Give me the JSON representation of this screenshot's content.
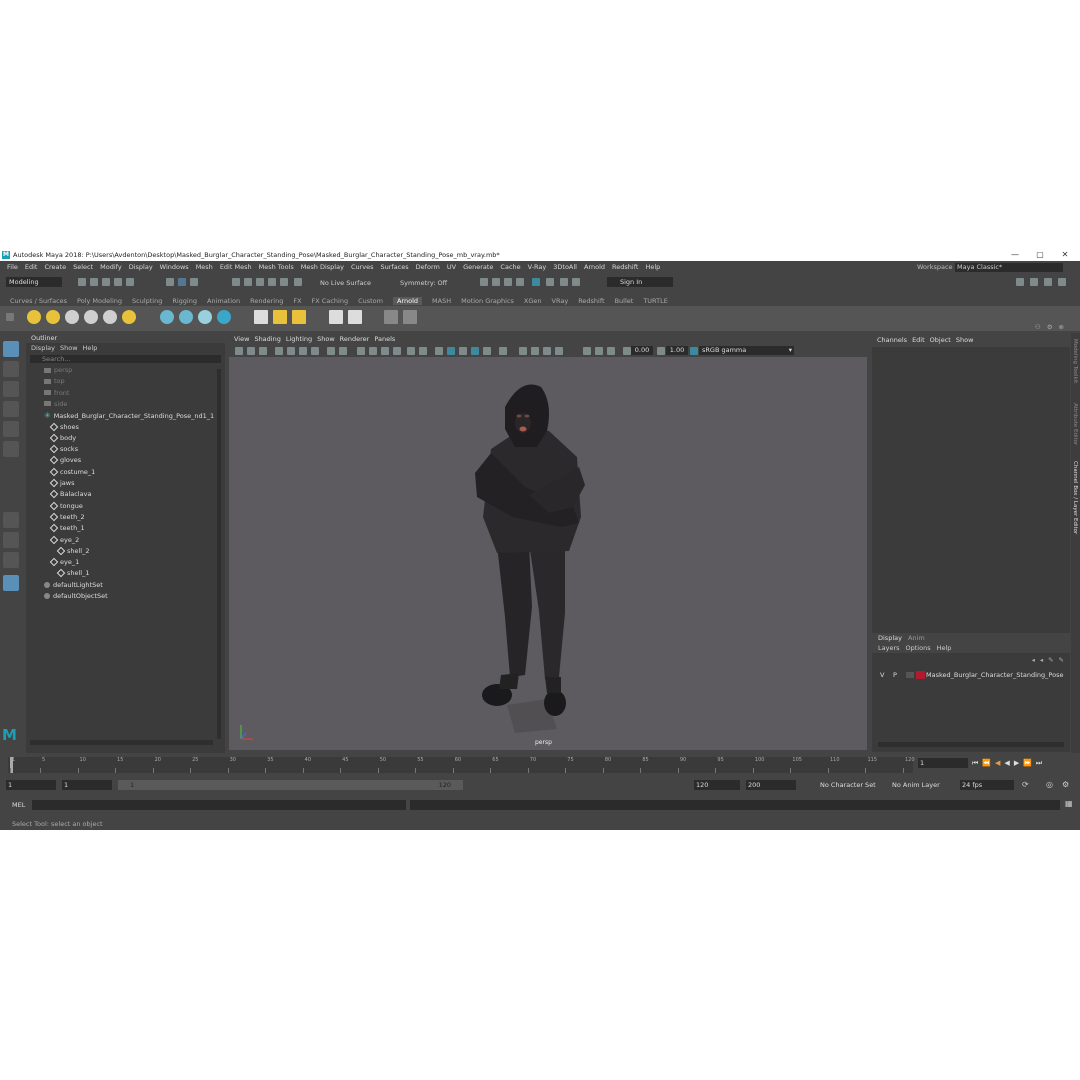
{
  "window": {
    "title": "Autodesk Maya 2018: P:\\Users\\Avdenton\\Desktop\\Masked_Burglar_Character_Standing_Pose\\Masked_Burglar_Character_Standing_Pose_mb_vray.mb*",
    "logo": "M",
    "minimize": "—",
    "maximize": "▢",
    "close": "✕"
  },
  "menu": [
    "File",
    "Edit",
    "Create",
    "Select",
    "Modify",
    "Display",
    "Windows",
    "Mesh",
    "Edit Mesh",
    "Mesh Tools",
    "Mesh Display",
    "Curves",
    "Surfaces",
    "Deform",
    "UV",
    "Generate",
    "Cache",
    "V-Ray",
    "3DtoAll",
    "Arnold",
    "Redshift",
    "Help"
  ],
  "workspace": {
    "label": "Workspace :",
    "value": "Maya Classic*"
  },
  "toolbar": {
    "mode": "Modeling",
    "live_surface": "No Live Surface",
    "symmetry": "Symmetry: Off",
    "sign_in": "Sign In"
  },
  "shelf_tabs": [
    "Curves / Surfaces",
    "Poly Modeling",
    "Sculpting",
    "Rigging",
    "Animation",
    "Rendering",
    "FX",
    "FX Caching",
    "Custom",
    "Arnold",
    "MASH",
    "Motion Graphics",
    "XGen",
    "VRay",
    "Redshift",
    "Bullet",
    "TURTLE"
  ],
  "active_shelf_tab": "Arnold",
  "outliner": {
    "title": "Outliner",
    "menu": [
      "Display",
      "Show",
      "Help"
    ],
    "search_placeholder": "Search...",
    "items": [
      {
        "label": "persp",
        "type": "camera",
        "depth": 0,
        "dim": true
      },
      {
        "label": "top",
        "type": "camera",
        "depth": 0,
        "dim": true
      },
      {
        "label": "front",
        "type": "camera",
        "depth": 0,
        "dim": true
      },
      {
        "label": "side",
        "type": "camera",
        "depth": 0,
        "dim": true
      },
      {
        "label": "Masked_Burglar_Character_Standing_Pose_nd1_1",
        "type": "group",
        "depth": 0,
        "dim": false
      },
      {
        "label": "shoes",
        "type": "mesh",
        "depth": 1,
        "dim": false
      },
      {
        "label": "body",
        "type": "mesh",
        "depth": 1,
        "dim": false
      },
      {
        "label": "socks",
        "type": "mesh",
        "depth": 1,
        "dim": false
      },
      {
        "label": "gloves",
        "type": "mesh",
        "depth": 1,
        "dim": false
      },
      {
        "label": "costume_1",
        "type": "mesh",
        "depth": 1,
        "dim": false
      },
      {
        "label": "jaws",
        "type": "mesh",
        "depth": 1,
        "dim": false
      },
      {
        "label": "Balaclava",
        "type": "mesh",
        "depth": 1,
        "dim": false
      },
      {
        "label": "tongue",
        "type": "mesh",
        "depth": 1,
        "dim": false
      },
      {
        "label": "teeth_2",
        "type": "mesh",
        "depth": 1,
        "dim": false
      },
      {
        "label": "teeth_1",
        "type": "mesh",
        "depth": 1,
        "dim": false
      },
      {
        "label": "eye_2",
        "type": "mesh",
        "depth": 1,
        "dim": false
      },
      {
        "label": "shell_2",
        "type": "mesh",
        "depth": 2,
        "dim": false
      },
      {
        "label": "eye_1",
        "type": "mesh",
        "depth": 1,
        "dim": false
      },
      {
        "label": "shell_1",
        "type": "mesh",
        "depth": 2,
        "dim": false
      },
      {
        "label": "defaultLightSet",
        "type": "set",
        "depth": 0,
        "dim": false
      },
      {
        "label": "defaultObjectSet",
        "type": "set",
        "depth": 0,
        "dim": false
      }
    ]
  },
  "viewport": {
    "menu": [
      "View",
      "Shading",
      "Lighting",
      "Show",
      "Renderer",
      "Panels"
    ],
    "exposure": "0.00",
    "gamma_value": "1.00",
    "color_space": "sRGB gamma",
    "camera_label": "persp"
  },
  "channel_box": {
    "menu": [
      "Channels",
      "Edit",
      "Object",
      "Show"
    ]
  },
  "layer_editor": {
    "tabs": [
      "Display",
      "Anim"
    ],
    "menu": [
      "Layers",
      "Options",
      "Help"
    ],
    "layer": {
      "v": "V",
      "p": "P",
      "name": "Masked_Burglar_Character_Standing_Pose",
      "color": "#b01a2e"
    }
  },
  "side_tabs": [
    "Modeling Toolkit",
    "Attribute Editor",
    "Channel Box / Layer Editor"
  ],
  "timeline": {
    "ticks": [
      "1",
      "5",
      "10",
      "15",
      "20",
      "25",
      "30",
      "35",
      "40",
      "45",
      "50",
      "55",
      "60",
      "65",
      "70",
      "75",
      "80",
      "85",
      "90",
      "95",
      "100",
      "105",
      "110",
      "115",
      "120"
    ],
    "current_frame": "1"
  },
  "range": {
    "start": "1",
    "playback_start": "1",
    "slider_start": "1",
    "slider_end": "120",
    "playback_end": "120",
    "end": "200",
    "character_set": "No Character Set",
    "anim_layer": "No Anim Layer",
    "fps": "24 fps"
  },
  "command": {
    "lang": "MEL"
  },
  "help_line": "Select Tool: select an object",
  "colors": {
    "accent": "#1a9fb6",
    "bg": "#444444",
    "panel": "#3b3b3b",
    "viewport": "#5d5b5f"
  }
}
